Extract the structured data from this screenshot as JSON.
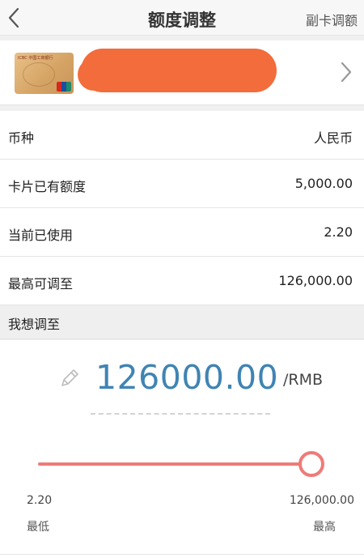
{
  "header": {
    "title": "额度调整",
    "right_link": "副卡调额"
  },
  "card": {
    "bank_text": "ICBC 中国工商银行"
  },
  "rows": [
    {
      "label": "币种",
      "value": "人民币"
    },
    {
      "label": "卡片已有额度",
      "value": "5,000.00"
    },
    {
      "label": "当前已使用",
      "value": "2.20"
    },
    {
      "label": "最高可调至",
      "value": "126,000.00"
    }
  ],
  "adjust": {
    "section_title": "我想调至",
    "amount": "126000.00",
    "unit": "/RMB",
    "slider_fraction": 1.0,
    "min_value": "2.20",
    "max_value": "126,000.00",
    "min_label": "最低",
    "max_label": "最高"
  },
  "colors": {
    "amount": "#3f84b3",
    "slider": "#ee7b78",
    "redaction": "#f26c3c"
  }
}
